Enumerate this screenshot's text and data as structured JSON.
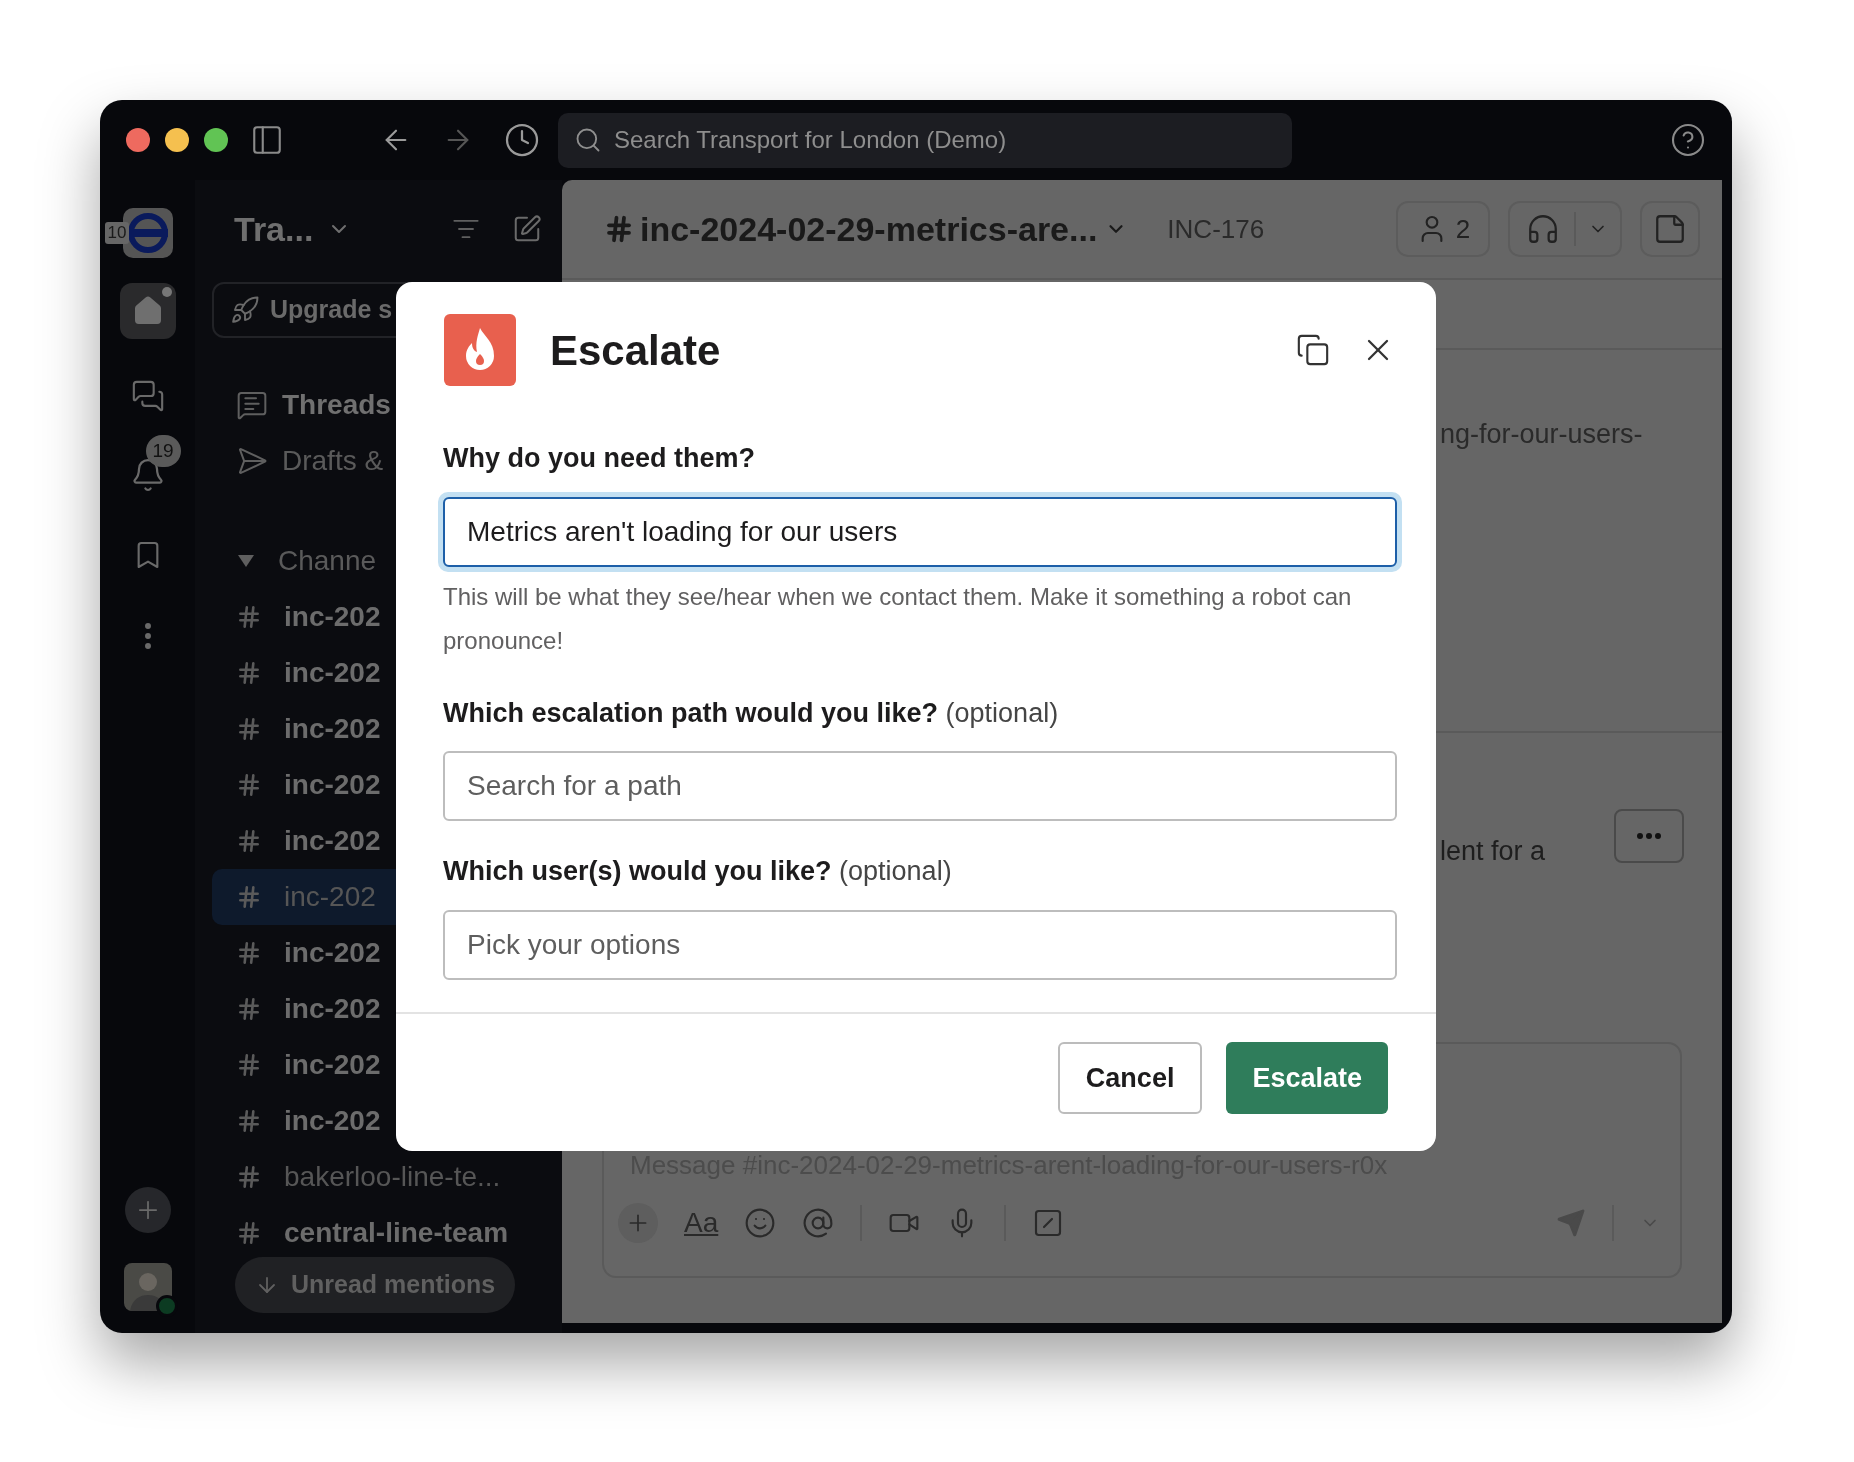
{
  "window": {
    "search_placeholder": "Search Transport for London (Demo)"
  },
  "workspace_rail": {
    "workspace_badge": "10",
    "activity_badge": "19"
  },
  "sidebar": {
    "workspace_name": "Tra...",
    "upgrade": "Upgrade s",
    "nav": [
      {
        "label": "Threads",
        "unread": true
      },
      {
        "label": "Drafts &",
        "unread": false
      }
    ],
    "section": {
      "label": "Channe",
      "expanded": true
    },
    "channels": [
      {
        "name": "inc-202",
        "unread": true,
        "selected": false
      },
      {
        "name": "inc-202",
        "unread": true,
        "selected": false
      },
      {
        "name": "inc-202",
        "unread": true,
        "selected": false
      },
      {
        "name": "inc-202",
        "unread": true,
        "selected": false
      },
      {
        "name": "inc-202",
        "unread": true,
        "selected": false
      },
      {
        "name": "inc-202",
        "unread": false,
        "selected": true
      },
      {
        "name": "inc-202",
        "unread": true,
        "selected": false
      },
      {
        "name": "inc-202",
        "unread": true,
        "selected": false
      },
      {
        "name": "inc-202",
        "unread": true,
        "selected": false
      },
      {
        "name": "inc-202",
        "unread": true,
        "selected": false
      },
      {
        "name": "bakerloo-line-te...",
        "unread": false,
        "selected": false
      },
      {
        "name": "central-line-team",
        "unread": true,
        "selected": false
      }
    ],
    "unread_mentions": "Unread mentions"
  },
  "channel_header": {
    "title": "inc-2024-02-29-metrics-are...",
    "incident_id": "INC-176",
    "member_count": "2"
  },
  "messages": [
    {
      "text": "ng-for-our-users-"
    },
    {
      "text": "lent for a"
    }
  ],
  "composer": {
    "placeholder": "Message #inc-2024-02-29-metrics-arent-loading-for-our-users-r0x",
    "format_label": "Aa"
  },
  "modal": {
    "title": "Escalate",
    "fields": [
      {
        "label": "Why do you need them?",
        "value": "Metrics aren't loading for our users",
        "focused": true,
        "hint": "This will be what they see/hear when we contact them. Make it something a robot can pronounce!"
      },
      {
        "label": "Which escalation path would you like?",
        "note": "(optional)",
        "placeholder": "Search for a path",
        "focused": false
      },
      {
        "label": "Which user(s) would you like?",
        "note": "(optional)",
        "placeholder": "Pick your options",
        "focused": false
      }
    ],
    "buttons": [
      {
        "label": "Cancel",
        "kind": "secondary"
      },
      {
        "label": "Escalate",
        "kind": "primary"
      }
    ]
  }
}
